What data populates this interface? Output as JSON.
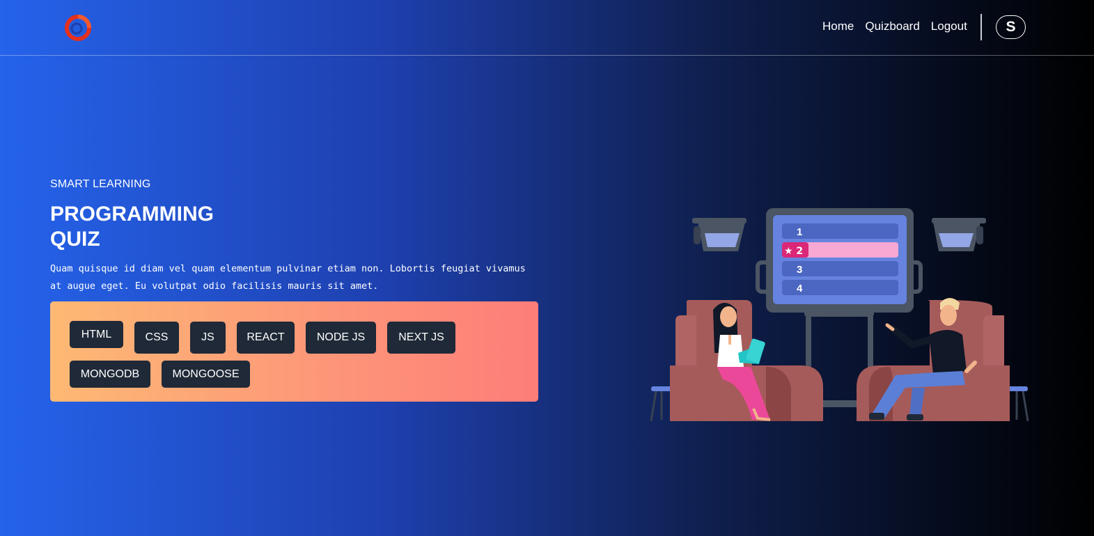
{
  "navbar": {
    "links": [
      "Home",
      "Quizboard",
      "Logout"
    ],
    "avatar_letter": "S"
  },
  "hero": {
    "eyebrow": "SMART LEARNING",
    "title": "PROGRAMMING QUIZ",
    "description": "Quam quisque id diam vel quam elementum pulvinar etiam non. Lobortis feugiat vivamus at augue eget. Eu volutpat odio facilisis mauris sit amet."
  },
  "tags": [
    "HTML",
    "CSS",
    "JS",
    "REACT",
    "NODE JS",
    "NEXT JS",
    "MONGODB",
    "MONGOOSE"
  ],
  "illustration": {
    "board_items": [
      "1",
      "★ 2",
      "3",
      "4"
    ]
  },
  "colors": {
    "logo": "#e5301d",
    "tag_bg": "#1f2937",
    "highlight": "#db2777"
  }
}
